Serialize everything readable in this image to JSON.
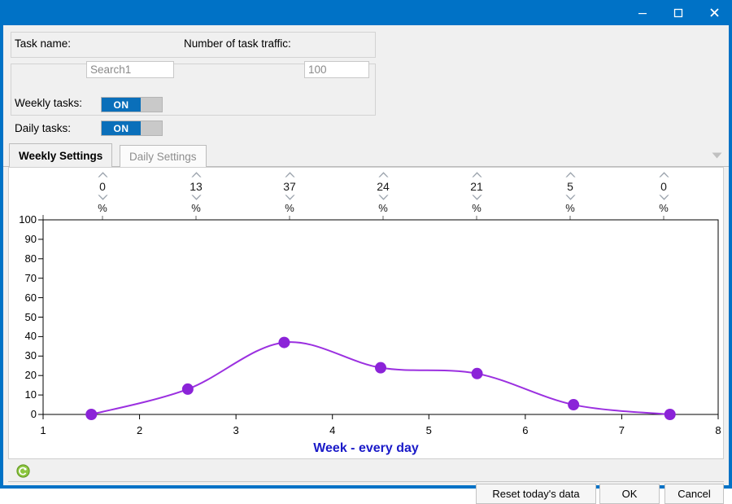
{
  "window": {
    "title": "",
    "controls": [
      {
        "name": "minimize-button",
        "icon": "minimize-icon"
      },
      {
        "name": "maximize-button",
        "icon": "maximize-icon"
      },
      {
        "name": "close-button",
        "icon": "close-icon"
      }
    ],
    "accent_color": "#0072c6"
  },
  "form": {
    "task_name_label": "Task name:",
    "task_name_value": "Search1",
    "task_name_placeholder": "Search1",
    "traffic_label": "Number of task traffic:",
    "traffic_value": "100",
    "traffic_placeholder": "100",
    "weekly_label": "Weekly tasks:",
    "weekly_state": "ON",
    "daily_label": "Daily tasks:",
    "daily_state": "ON"
  },
  "tabs": {
    "items": [
      {
        "label": "Weekly Settings",
        "active": true
      },
      {
        "label": "Daily Settings",
        "active": false
      }
    ],
    "overflow_icon": "chevron-down-icon"
  },
  "spinners": {
    "unit": "%",
    "up_icon": "chevron-up-icon",
    "down_icon": "chevron-down-icon",
    "values": [
      "0",
      "13",
      "37",
      "24",
      "21",
      "5",
      "0"
    ]
  },
  "chart_data": {
    "type": "line",
    "title": "",
    "xlabel": "Week - every day",
    "ylabel": "",
    "x": [
      1.5,
      2.5,
      3.5,
      4.5,
      5.5,
      6.5,
      7.5
    ],
    "values": [
      0,
      13,
      37,
      24,
      21,
      5,
      0
    ],
    "xticks": [
      "1",
      "2",
      "3",
      "4",
      "5",
      "6",
      "7",
      "8"
    ],
    "yticks": [
      "100",
      "90",
      "80",
      "70",
      "60",
      "50",
      "40",
      "30",
      "20",
      "10",
      "0"
    ],
    "xlim": [
      1,
      8
    ],
    "ylim": [
      0,
      100
    ],
    "grid": false,
    "legend": "none",
    "smooth": true,
    "line_color": "#9b30e0",
    "marker_color": "#8b23d8",
    "axis_title_color": "#1a1ac8"
  },
  "footer": {
    "refresh_icon": "refresh-icon",
    "reset_label": "Reset today's data",
    "ok_label": "OK",
    "cancel_label": "Cancel"
  }
}
